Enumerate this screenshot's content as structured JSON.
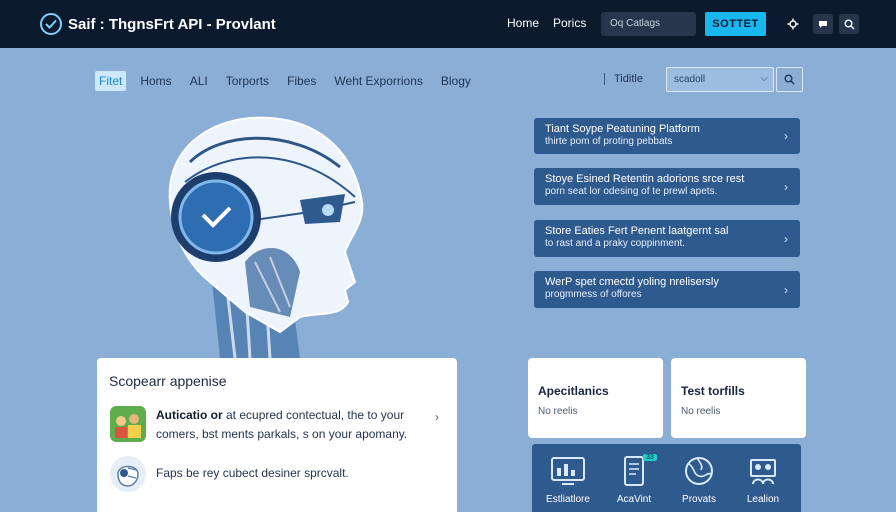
{
  "header": {
    "brand": "Saif : ThgnsFrt API - Provlant",
    "nav": [
      "Home",
      "Porics"
    ],
    "search_placeholder": "Oq Catlags",
    "cta": "SOTTET"
  },
  "subnav": {
    "items": [
      "Fitet",
      "Homs",
      "ALI",
      "Torports",
      "Fibes",
      "Weht Exporrions",
      "Blogy"
    ],
    "active_index": 0,
    "filter_label": "Tiditle",
    "filter_placeholder": "scadoll"
  },
  "features": [
    {
      "title": "Tiant Soype Peatuning Platform",
      "subtitle": "thirte pom of proting pebbats"
    },
    {
      "title": "Stoye Esined Retentin adorions srce rest",
      "subtitle": "porn seat lor odesing of te prewl apets."
    },
    {
      "title": "Store Eaties Fert Penent laatgernt sal",
      "subtitle": "to rast and a praky coppinment."
    },
    {
      "title": "WerP spet cmectd yoling nrelisersly",
      "subtitle": "progmmess of offores"
    }
  ],
  "panel": {
    "title": "Scopearr appenise",
    "rows": [
      {
        "bold": "Auticatio or",
        "text": " at ecupred contectual, the to your comers, bst ments parkals, s on your apomany."
      },
      {
        "bold": "",
        "text": "Faps be rey cubect desiner sprcvalt."
      }
    ]
  },
  "mini_cards": [
    {
      "title": "Apecitlanics",
      "subtitle": "No reelis"
    },
    {
      "title": "Test torfills",
      "subtitle": "No reelis"
    }
  ],
  "icon_panel": {
    "badge": "33",
    "items": [
      "Estliatlore",
      "AcaVint",
      "Provats",
      "Lealion"
    ]
  },
  "colors": {
    "topbar": "#0c1a2e",
    "background": "#8aaed6",
    "accent": "#18b8ee",
    "card_blue": "#2f5a8e"
  },
  "icons": [
    "check-circle-icon",
    "gear-icon",
    "chat-icon",
    "search-icon",
    "chevron-right-icon",
    "chevron-down-icon",
    "dashboard-icon",
    "tablet-icon",
    "globe-icon",
    "people-icon"
  ]
}
